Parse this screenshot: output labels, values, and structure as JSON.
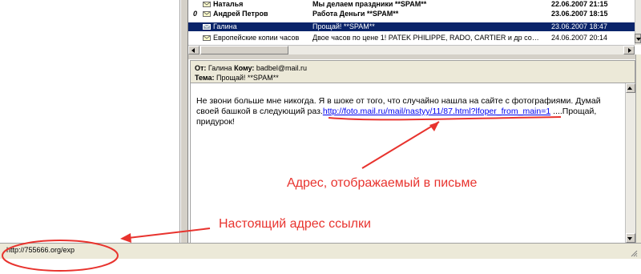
{
  "message_list": {
    "rows": [
      {
        "attach": "",
        "from": "Наталья",
        "subject": "Мы делаем праздники **SPAM**",
        "date": "22.06.2007 21:15",
        "style": "bold"
      },
      {
        "attach": "0",
        "from": "Андрей Петров",
        "subject": "Работа Деньги **SPAM**",
        "date": "23.06.2007 18:15",
        "style": "bold"
      },
      {
        "attach": "",
        "from": "Галина",
        "subject": "Прощай! **SPAM**",
        "date": "23.06.2007 18:47",
        "style": "selected"
      },
      {
        "attach": "",
        "from": "Европейские копии часов",
        "subject": "Двое часов по цене 1! PATEK PHILIPPE, RADO, CARTIER и др со…",
        "date": "24.06.2007 20:14",
        "style": "normal"
      }
    ]
  },
  "preview": {
    "from_label": "От:",
    "from_value": "Галина",
    "to_label": "Кому:",
    "to_value": "badbel@mail.ru",
    "subject_label": "Тема:",
    "subject_value": "Прощай! **SPAM**",
    "body_before_link": "Не звони больше мне никогда. Я в шоке от того, что случайно нашла на сайте с фотографиями. Думай своей башкой в следующий раз.",
    "body_link": "http://foto.mail.ru/mail/nastyy/11/87.html?lfoper_from_main=1",
    "body_after_link": " ....Прощай, придурок!"
  },
  "status_bar": {
    "url": "http://755666.org/exp"
  },
  "annotations": {
    "displayed_address": "Адрес, отображаемый в письме",
    "real_address": "Настоящий адрес ссылки",
    "color": "#e8332e"
  },
  "colors": {
    "selection": "#0a246a",
    "link": "#0000ee",
    "chrome": "#ece9d8"
  }
}
